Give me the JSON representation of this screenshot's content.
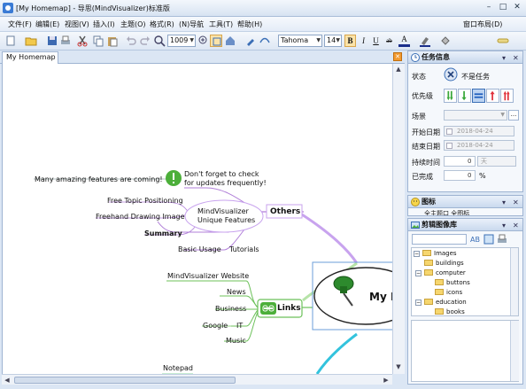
{
  "window": {
    "title": "[My Homemap] - 导思(MindVisualizer)标准版"
  },
  "menu": [
    "文件(F)",
    "编辑(E)",
    "视图(V)",
    "插入(I)",
    "主题(O)",
    "格式(R)",
    "(N)导航",
    "工具(T)",
    "帮助(H)"
  ],
  "menu_right": "窗口布局(D)",
  "toolbar": {
    "zoom": "1009",
    "font": "Tahoma",
    "font_size": "14",
    "bold": "B",
    "italic": "I",
    "underline": "U",
    "strike": "ab",
    "font_color_icon": "A"
  },
  "tab": {
    "label": "My Homemap"
  },
  "mindmap": {
    "many_features": "Many amazing features are coming!",
    "dont_forget_line1": "Don't forget to check",
    "dont_forget_line2": "for updates frequently!",
    "free_topic": "Free Topic Positioning",
    "freehand": "Freehand Drawing Image",
    "unique_line1": "MindVisualizer",
    "unique_line2": "Unique Features",
    "others": "Others",
    "summary": "Summary",
    "basic_usage": "Basic Usage",
    "tutorials": "Tutorials",
    "website": "MindVisualizer Website",
    "news": "News",
    "business": "Business",
    "google": "Google",
    "it": "IT",
    "music": "Music",
    "links": "Links",
    "central": "My H",
    "notepad": "Notepad"
  },
  "task_panel": {
    "title": "任务信息",
    "status_label": "状态",
    "status_value": "不是任务",
    "priority_label": "优先级",
    "scene_label": "场景",
    "start_label": "开始日期",
    "start_value": "2018-04-24",
    "end_label": "结束日期",
    "end_value": "2018-04-24",
    "duration_label": "持续时间",
    "duration_value": "0",
    "duration_unit": "天",
    "done_label": "已完成",
    "done_value": "0",
    "done_unit": "%"
  },
  "icon_panel": {
    "title": "图标",
    "partial": "全主题口  全图标"
  },
  "clipart_panel": {
    "title": "剪辑图像库",
    "tree": [
      "Images",
      "buildings",
      "computer",
      "buttons",
      "icons",
      "education",
      "books"
    ]
  },
  "colors": {
    "accent": "#3b6fb6",
    "links_green": "#4caf3a",
    "others_purple": "#b07fd8",
    "priority_green": "#3aa83a",
    "priority_red": "#e0303a"
  }
}
